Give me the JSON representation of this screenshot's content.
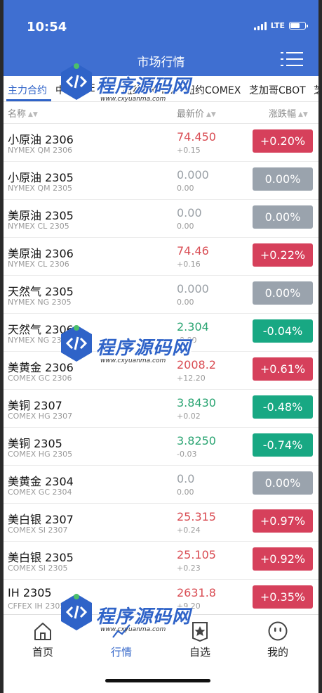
{
  "status": {
    "time": "10:54",
    "network": "LTE"
  },
  "header": {
    "title": "市场行情",
    "menu_icon": "list-menu-icon"
  },
  "tabs": [
    {
      "label": "主力合约",
      "active": true
    },
    {
      "label": "中",
      "active": false
    },
    {
      "label": "CME",
      "active": false
    },
    {
      "label": "纽约NYMEX",
      "active": false
    },
    {
      "label": "纽约COMEX",
      "active": false
    },
    {
      "label": "芝加哥CBOT",
      "active": false
    },
    {
      "label": "芝",
      "active": false
    }
  ],
  "columns": {
    "name": "名称",
    "price": "最新价",
    "change": "涨跌幅"
  },
  "rows": [
    {
      "name": "小原油 2306",
      "code": "NYMEX QM 2306",
      "price": "74.450",
      "change": "+0.15",
      "pct": "+0.20%",
      "trend": "up"
    },
    {
      "name": "小原油 2305",
      "code": "NYMEX QM 2305",
      "price": "0.000",
      "change": "0.00",
      "pct": "0.00%",
      "trend": "flat"
    },
    {
      "name": "美原油 2305",
      "code": "NYMEX CL 2305",
      "price": "0.00",
      "change": "0.00",
      "pct": "0.00%",
      "trend": "flat"
    },
    {
      "name": "美原油 2306",
      "code": "NYMEX CL 2306",
      "price": "74.46",
      "change": "+0.16",
      "pct": "+0.22%",
      "trend": "up"
    },
    {
      "name": "天然气 2305",
      "code": "NYMEX NG 2305",
      "price": "0.000",
      "change": "0.00",
      "pct": "0.00%",
      "trend": "flat"
    },
    {
      "name": "天然气 2306",
      "code": "NYMEX NG 2306",
      "price": "2.304",
      "change": "-0.00",
      "pct": "-0.04%",
      "trend": "down"
    },
    {
      "name": "美黄金 2306",
      "code": "COMEX GC 2306",
      "price": "2008.2",
      "change": "+12.20",
      "pct": "+0.61%",
      "trend": "up"
    },
    {
      "name": "美铜 2307",
      "code": "COMEX HG 2307",
      "price": "3.8430",
      "change": "+0.02",
      "pct": "-0.48%",
      "trend": "down"
    },
    {
      "name": "美铜 2305",
      "code": "COMEX HG 2305",
      "price": "3.8250",
      "change": "-0.03",
      "pct": "-0.74%",
      "trend": "down"
    },
    {
      "name": "美黄金 2304",
      "code": "COMEX GC 2304",
      "price": "0.0",
      "change": "0.00",
      "pct": "0.00%",
      "trend": "flat"
    },
    {
      "name": "美白银 2307",
      "code": "COMEX SI 2307",
      "price": "25.315",
      "change": "+0.24",
      "pct": "+0.97%",
      "trend": "up"
    },
    {
      "name": "美白银 2305",
      "code": "COMEX SI 2305",
      "price": "25.105",
      "change": "+0.23",
      "pct": "+0.92%",
      "trend": "up"
    },
    {
      "name": "IH 2305",
      "code": "CFFEX IH 2305",
      "price": "2631.8",
      "change": "+9.20",
      "pct": "+0.35%",
      "trend": "up"
    }
  ],
  "bottom_nav": [
    {
      "label": "首页",
      "icon": "home-icon",
      "active": false
    },
    {
      "label": "行情",
      "icon": "chart-icon",
      "active": true
    },
    {
      "label": "自选",
      "icon": "star-icon",
      "active": false
    },
    {
      "label": "我的",
      "icon": "user-face-icon",
      "active": false
    }
  ],
  "watermark": {
    "text": "程序源码网",
    "url": "www.cxyuanma.com"
  },
  "colors": {
    "brand": "#3f6fd1",
    "up": "#d6405b",
    "down": "#18a883",
    "flat": "#9aa3ad"
  }
}
